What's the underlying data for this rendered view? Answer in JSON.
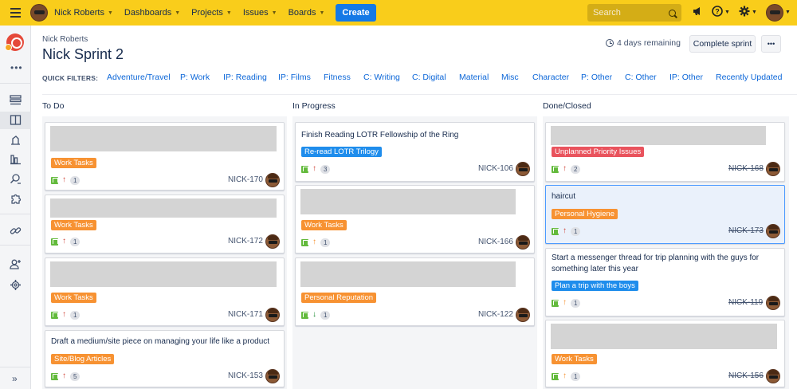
{
  "topbar": {
    "user_name": "Nick Roberts",
    "nav": [
      {
        "label": "Dashboards"
      },
      {
        "label": "Projects"
      },
      {
        "label": "Issues"
      },
      {
        "label": "Boards"
      }
    ],
    "create_label": "Create",
    "search_placeholder": "Search",
    "icons": [
      "megaphone-icon",
      "help-icon",
      "settings-icon",
      "user-avatar"
    ]
  },
  "sidebar": {
    "more": "•••",
    "expand": "»"
  },
  "header": {
    "breadcrumb": "Nick Roberts",
    "title": "Nick Sprint 2",
    "remaining": "4 days remaining",
    "complete_label": "Complete sprint",
    "more_label": "•••"
  },
  "quick_filters": {
    "label": "QUICK FILTERS:",
    "items": [
      "Adventure/Travel",
      "P: Work",
      "IP: Reading",
      "IP: Films",
      "Fitness",
      "C: Writing",
      "C: Digital",
      "Material",
      "Misc",
      "Character",
      "P: Other",
      "C: Other",
      "IP: Other",
      "Recently Updated"
    ]
  },
  "colors": {
    "topbar": "#f9cd1b",
    "create": "#1479e6",
    "link": "#0b66d8",
    "orange_label": "#f79232",
    "blue_label": "#1f8dec",
    "red_label": "#e9535d",
    "story_green": "#63ba3c"
  },
  "columns": [
    {
      "title": "To Do",
      "cards": [
        {
          "summary": "",
          "label": "Work Tasks",
          "priority": "↑",
          "points": "1",
          "key": "NICK-170"
        },
        {
          "summary": "",
          "label": "Work Tasks",
          "priority": "↑",
          "points": "1",
          "key": "NICK-172"
        },
        {
          "summary": "",
          "label": "Work Tasks",
          "priority": "↑",
          "points": "1",
          "key": "NICK-171"
        },
        {
          "summary": "Draft a medium/site piece on managing your life like a product",
          "label": "Site/Blog Articles",
          "priority": "↑",
          "points": "5",
          "key": "NICK-153"
        }
      ]
    },
    {
      "title": "In Progress",
      "cards": [
        {
          "summary": "Finish Reading LOTR Fellowship of the Ring",
          "label": "Re-read LOTR Trilogy",
          "priority": "↑",
          "points": "3",
          "key": "NICK-106"
        },
        {
          "summary": "",
          "label": "Work Tasks",
          "priority": "↑",
          "points": "1",
          "key": "NICK-166"
        },
        {
          "summary": "",
          "label": "Personal Reputation",
          "priority": "↓",
          "points": "1",
          "key": "NICK-122"
        }
      ]
    },
    {
      "title": "Done/Closed",
      "cards": [
        {
          "summary": "",
          "label": "Unplanned Priority Issues",
          "priority": "↑",
          "points": "2",
          "key": "NICK-168"
        },
        {
          "summary": "haircut",
          "label": "Personal Hygiene",
          "priority": "↑",
          "points": "1",
          "key": "NICK-173"
        },
        {
          "summary_line1": "Start a messenger thread for trip planning with the guys for",
          "summary_line2": "something later this year",
          "label": "Plan a trip with the boys",
          "priority": "↑",
          "points": "1",
          "key": "NICK-119"
        },
        {
          "summary": "",
          "label": "Work Tasks",
          "priority": "↑",
          "points": "1",
          "key": "NICK-156"
        }
      ]
    }
  ]
}
